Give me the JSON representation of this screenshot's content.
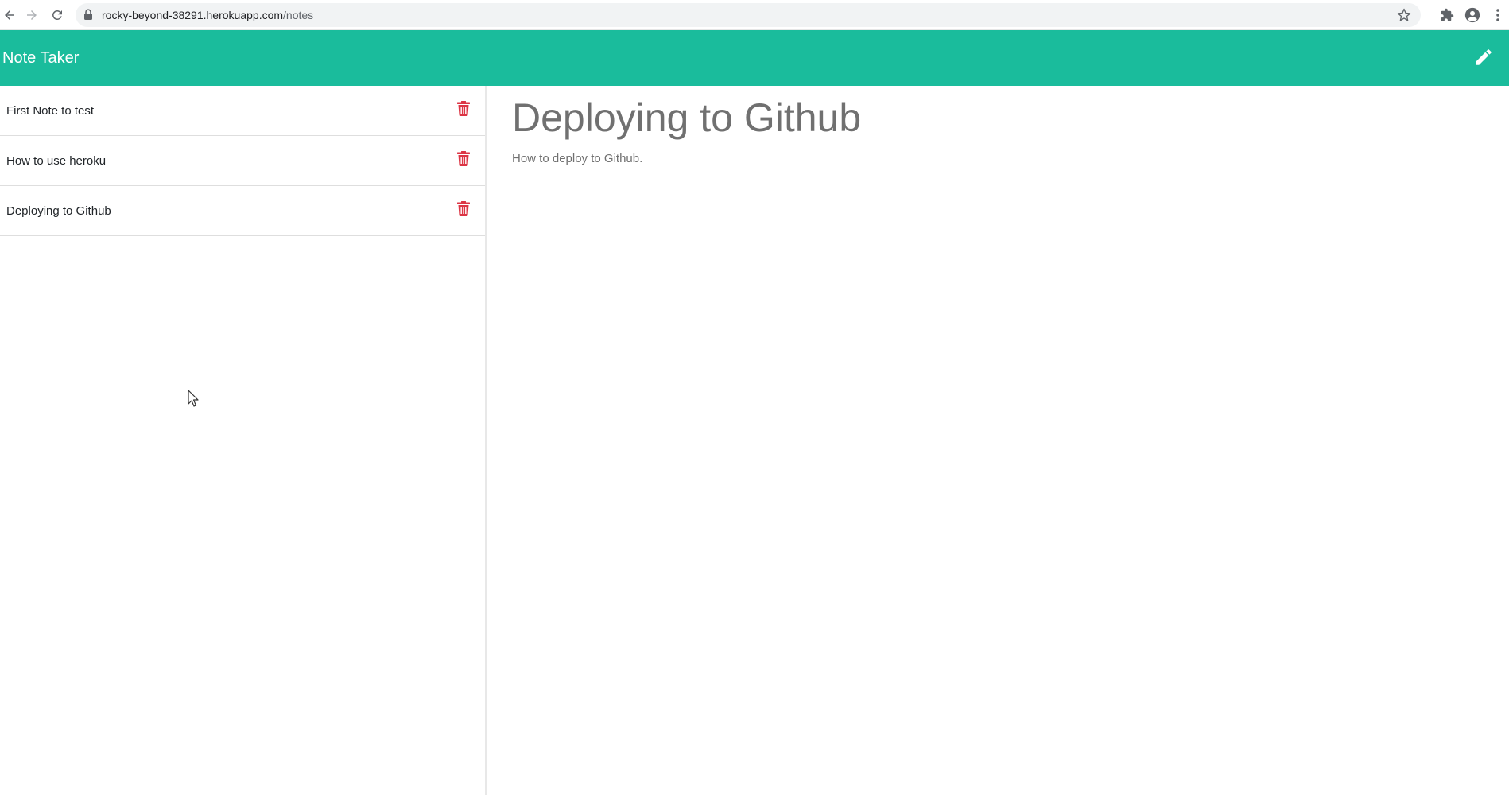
{
  "browser": {
    "url_host": "rocky-beyond-38291.herokuapp.com",
    "url_path": "/notes",
    "icons": {
      "back": "back-arrow-icon",
      "forward": "forward-arrow-icon",
      "reload": "reload-icon",
      "lock": "lock-icon",
      "bookmark": "star-icon",
      "extensions": "puzzle-icon",
      "profile": "account-icon",
      "menu": "kebab-menu-icon"
    }
  },
  "app": {
    "brand": "Note Taker",
    "accent_color": "#1abc9c",
    "new_note_icon": "pencil-icon",
    "delete_icon": "trash-icon",
    "delete_color": "#dc3545"
  },
  "notes": [
    {
      "title": "First Note to test"
    },
    {
      "title": "How to use heroku"
    },
    {
      "title": "Deploying to Github"
    }
  ],
  "active_note": {
    "title": "Deploying to Github",
    "text": "How to deploy to Github."
  }
}
